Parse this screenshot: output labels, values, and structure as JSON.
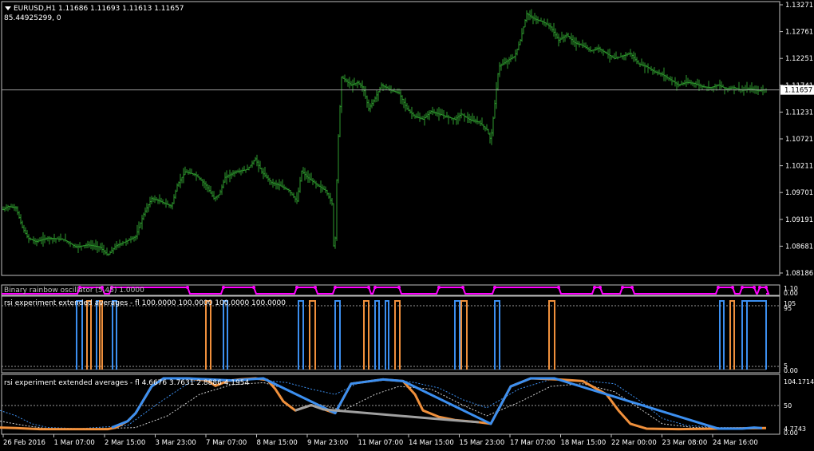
{
  "header": {
    "symbol_line": "EURUSD,H1  1.11686 1.11693 1.11613 1.11657",
    "value_line": "85.44925299, 0"
  },
  "colors": {
    "background": "#000000",
    "frame": "#c0c0c0",
    "candles": "#2e9a2e",
    "bid_line": "#9a9a9a",
    "rainbow": "#ff00ff",
    "bull": "#3c8ff0",
    "bear": "#f0903c",
    "neutral": "#a0a0a0",
    "dotted_blue": "#3c8ff0",
    "dotted_white": "#d0d0d0"
  },
  "icons": {
    "collapse": "triangle-down-icon"
  },
  "chart_data": [
    {
      "type": "candlestick",
      "name": "EURUSD,H1",
      "price_axis": {
        "ylim": [
          1.08186,
          1.13271
        ],
        "ticks": [
          "1.13271",
          "1.12761",
          "1.12251",
          "1.11741",
          "1.11231",
          "1.10721",
          "1.10211",
          "1.09701",
          "1.09191",
          "1.08681",
          "1.08186"
        ],
        "current_price": "1.11657",
        "current_price_value": 1.11657
      },
      "time_axis": {
        "labels": [
          "26 Feb 2016",
          "1 Mar 07:00",
          "2 Mar 15:00",
          "3 Mar 23:00",
          "7 Mar 07:00",
          "8 Mar 15:00",
          "9 Mar 23:00",
          "11 Mar 07:00",
          "14 Mar 15:00",
          "15 Mar 23:00",
          "17 Mar 07:00",
          "18 Mar 15:00",
          "22 Mar 00:00",
          "23 Mar 08:00",
          "24 Mar 16:00"
        ]
      },
      "path": [
        [
          0,
          1.0935
        ],
        [
          10,
          1.0945
        ],
        [
          20,
          1.0942
        ],
        [
          28,
          1.0905
        ],
        [
          35,
          1.0885
        ],
        [
          45,
          1.0878
        ],
        [
          60,
          1.0885
        ],
        [
          80,
          1.0882
        ],
        [
          95,
          1.0868
        ],
        [
          110,
          1.0872
        ],
        [
          125,
          1.0868
        ],
        [
          135,
          1.0852
        ],
        [
          145,
          1.087
        ],
        [
          160,
          1.088
        ],
        [
          170,
          1.0888
        ],
        [
          180,
          1.093
        ],
        [
          190,
          1.096
        ],
        [
          200,
          1.0955
        ],
        [
          215,
          1.0945
        ],
        [
          222,
          1.0985
        ],
        [
          232,
          1.101
        ],
        [
          245,
          1.1005
        ],
        [
          258,
          1.0985
        ],
        [
          268,
          1.096
        ],
        [
          275,
          1.0968
        ],
        [
          282,
          1.1
        ],
        [
          295,
          1.101
        ],
        [
          310,
          1.1015
        ],
        [
          320,
          1.1035
        ],
        [
          328,
          1.101
        ],
        [
          340,
          1.099
        ],
        [
          350,
          1.0985
        ],
        [
          362,
          1.0975
        ],
        [
          372,
          1.0955
        ],
        [
          378,
          1.1012
        ],
        [
          385,
          1.1
        ],
        [
          398,
          1.0985
        ],
        [
          408,
          1.0975
        ],
        [
          416,
          1.095
        ],
        [
          419,
          1.083
        ],
        [
          423,
          1.105
        ],
        [
          428,
          1.119
        ],
        [
          440,
          1.1175
        ],
        [
          448,
          1.118
        ],
        [
          455,
          1.117
        ],
        [
          462,
          1.113
        ],
        [
          470,
          1.115
        ],
        [
          478,
          1.1175
        ],
        [
          490,
          1.1165
        ],
        [
          500,
          1.116
        ],
        [
          510,
          1.113
        ],
        [
          520,
          1.1115
        ],
        [
          530,
          1.111
        ],
        [
          540,
          1.1125
        ],
        [
          550,
          1.112
        ],
        [
          560,
          1.1115
        ],
        [
          570,
          1.111
        ],
        [
          578,
          1.112
        ],
        [
          590,
          1.1108
        ],
        [
          600,
          1.1105
        ],
        [
          610,
          1.109
        ],
        [
          615,
          1.107
        ],
        [
          620,
          1.114
        ],
        [
          625,
          1.121
        ],
        [
          635,
          1.122
        ],
        [
          645,
          1.123
        ],
        [
          652,
          1.126
        ],
        [
          660,
          1.131
        ],
        [
          670,
          1.13
        ],
        [
          680,
          1.1295
        ],
        [
          690,
          1.1285
        ],
        [
          700,
          1.126
        ],
        [
          710,
          1.127
        ],
        [
          720,
          1.1255
        ],
        [
          730,
          1.125
        ],
        [
          740,
          1.124
        ],
        [
          750,
          1.1245
        ],
        [
          760,
          1.1235
        ],
        [
          770,
          1.1225
        ],
        [
          780,
          1.123
        ],
        [
          790,
          1.1235
        ],
        [
          800,
          1.1215
        ],
        [
          810,
          1.121
        ],
        [
          820,
          1.12
        ],
        [
          830,
          1.1195
        ],
        [
          840,
          1.1185
        ],
        [
          850,
          1.1175
        ],
        [
          860,
          1.118
        ],
        [
          870,
          1.1178
        ],
        [
          880,
          1.1172
        ],
        [
          890,
          1.117
        ],
        [
          900,
          1.1175
        ],
        [
          910,
          1.1168
        ],
        [
          920,
          1.117
        ],
        [
          930,
          1.1165
        ],
        [
          940,
          1.1168
        ],
        [
          950,
          1.1164
        ],
        [
          958,
          1.1166
        ]
      ]
    },
    {
      "type": "line",
      "title": "Binary rainbow oscillator (5,45) 1.0000",
      "x_range": [
        0,
        960
      ],
      "series": [
        {
          "color_key": "rainbow",
          "levels": [
            0,
            1
          ],
          "high_segments": [
            [
              100,
              128
            ],
            [
              140,
              235
            ],
            [
              280,
              318
            ],
            [
              372,
              395
            ],
            [
              420,
              462
            ],
            [
              470,
              500
            ],
            [
              550,
              580
            ],
            [
              620,
              700
            ],
            [
              745,
              752
            ],
            [
              780,
              792
            ],
            [
              900,
              918
            ],
            [
              930,
              945
            ],
            [
              952,
              960
            ]
          ]
        }
      ],
      "axis_labels": [
        "1.10",
        "0.00"
      ]
    },
    {
      "type": "line",
      "title": "rsi experiment extended averages - fl 100.0000 100.0000 100.0000 100.0000",
      "x_range": [
        0,
        960
      ],
      "ylim": [
        0,
        100
      ],
      "levels": [
        95,
        5
      ],
      "axis_labels": [
        "105",
        "95",
        "5",
        "0.00"
      ],
      "series": [
        {
          "name": "",
          "color_key": "bull",
          "segments": [
            [
              96,
              103,
              100
            ],
            [
              121,
              125,
              100
            ],
            [
              141,
              146,
              100
            ],
            [
              280,
              285,
              100
            ],
            [
              374,
              380,
              100
            ],
            [
              420,
              426,
              100
            ],
            [
              470,
              475,
              100
            ],
            [
              483,
              487,
              100
            ],
            [
              570,
              576,
              100
            ],
            [
              620,
              626,
              100
            ],
            [
              902,
              907,
              100
            ],
            [
              930,
              936,
              100
            ],
            [
              936,
              960,
              100
            ]
          ]
        },
        {
          "name": "",
          "color_key": "bear",
          "segments": [
            [
              109,
              114,
              100
            ],
            [
              125,
              128,
              100
            ],
            [
              258,
              264,
              100
            ],
            [
              388,
              395,
              100
            ],
            [
              456,
              462,
              100
            ],
            [
              495,
              501,
              100
            ],
            [
              578,
              585,
              100
            ],
            [
              688,
              695,
              100
            ],
            [
              915,
              920,
              100
            ]
          ]
        }
      ]
    },
    {
      "type": "line",
      "title": "rsi experiment extended averages - fl 4.6676 3.7631 2.8886 4.1954",
      "x_range": [
        0,
        960
      ],
      "ylim": [
        4.7743,
        104.1714
      ],
      "axis_labels": [
        "104.1714",
        "50",
        "4.7743",
        "0.00"
      ],
      "series": [
        {
          "name": "",
          "color_key": "bear",
          "points": [
            [
              0,
              8
            ],
            [
              20,
              7
            ],
            [
              50,
              5
            ],
            [
              100,
              5
            ],
            [
              135,
              5
            ],
            [
              145,
              8
            ],
            [
              160,
              20
            ],
            [
              170,
              35
            ],
            [
              180,
              60
            ],
            [
              190,
              85
            ],
            [
              205,
              100
            ],
            [
              235,
              100
            ],
            [
              260,
              96
            ],
            [
              270,
              86
            ],
            [
              285,
              95
            ],
            [
              300,
              98
            ],
            [
              320,
              100
            ],
            [
              335,
              97
            ],
            [
              345,
              80
            ],
            [
              355,
              57
            ],
            [
              370,
              40
            ],
            [
              380,
              45
            ],
            [
              390,
              50
            ],
            [
              410,
              40
            ],
            [
              420,
              35
            ],
            [
              440,
              90
            ],
            [
              480,
              98
            ],
            [
              505,
              95
            ],
            [
              520,
              70
            ],
            [
              530,
              40
            ],
            [
              550,
              28
            ],
            [
              570,
              22
            ],
            [
              600,
              18
            ],
            [
              615,
              15
            ],
            [
              640,
              85
            ],
            [
              665,
              100
            ],
            [
              700,
              98
            ],
            [
              730,
              95
            ],
            [
              760,
              70
            ],
            [
              775,
              40
            ],
            [
              790,
              15
            ],
            [
              810,
              6
            ],
            [
              850,
              5
            ],
            [
              900,
              6
            ],
            [
              960,
              7
            ]
          ]
        },
        {
          "name": "",
          "color_key": "bull",
          "points": [
            [
              140,
              8
            ],
            [
              160,
              20
            ],
            [
              170,
              35
            ],
            [
              180,
              60
            ],
            [
              190,
              85
            ],
            [
              205,
              100
            ],
            [
              235,
              100
            ],
            [
              290,
              96
            ],
            [
              330,
              100
            ],
            [
              420,
              35
            ],
            [
              440,
              90
            ],
            [
              480,
              98
            ],
            [
              505,
              95
            ],
            [
              615,
              15
            ],
            [
              640,
              85
            ],
            [
              665,
              100
            ],
            [
              695,
              100
            ],
            [
              900,
              6
            ],
            [
              930,
              6
            ],
            [
              945,
              8
            ],
            [
              955,
              7
            ]
          ]
        },
        {
          "name": "",
          "color_key": "neutral",
          "points": [
            [
              370,
              40
            ],
            [
              380,
              45
            ],
            [
              390,
              50
            ],
            [
              405,
              42
            ],
            [
              565,
              22
            ],
            [
              600,
              18
            ]
          ]
        },
        {
          "name": "",
          "color_key": "dotted_blue",
          "points": [
            [
              0,
              40
            ],
            [
              20,
              30
            ],
            [
              40,
              15
            ],
            [
              60,
              8
            ],
            [
              100,
              6
            ],
            [
              160,
              12
            ],
            [
              200,
              55
            ],
            [
              240,
              95
            ],
            [
              280,
              98
            ],
            [
              320,
              98
            ],
            [
              360,
              92
            ],
            [
              390,
              80
            ],
            [
              420,
              70
            ],
            [
              450,
              92
            ],
            [
              490,
              98
            ],
            [
              520,
              92
            ],
            [
              550,
              82
            ],
            [
              580,
              60
            ],
            [
              610,
              45
            ],
            [
              650,
              80
            ],
            [
              690,
              98
            ],
            [
              730,
              96
            ],
            [
              770,
              90
            ],
            [
              800,
              60
            ],
            [
              830,
              25
            ],
            [
              860,
              12
            ],
            [
              900,
              8
            ],
            [
              960,
              8
            ]
          ]
        },
        {
          "name": "",
          "color_key": "dotted_white",
          "points": [
            [
              0,
              20
            ],
            [
              30,
              12
            ],
            [
              60,
              6
            ],
            [
              100,
              5
            ],
            [
              170,
              8
            ],
            [
              210,
              30
            ],
            [
              250,
              70
            ],
            [
              290,
              88
            ],
            [
              330,
              92
            ],
            [
              360,
              80
            ],
            [
              390,
              55
            ],
            [
              430,
              40
            ],
            [
              470,
              70
            ],
            [
              500,
              85
            ],
            [
              540,
              80
            ],
            [
              580,
              50
            ],
            [
              610,
              30
            ],
            [
              650,
              55
            ],
            [
              690,
              85
            ],
            [
              730,
              90
            ],
            [
              770,
              75
            ],
            [
              800,
              45
            ],
            [
              830,
              15
            ],
            [
              870,
              8
            ],
            [
              960,
              7
            ]
          ]
        }
      ]
    }
  ]
}
